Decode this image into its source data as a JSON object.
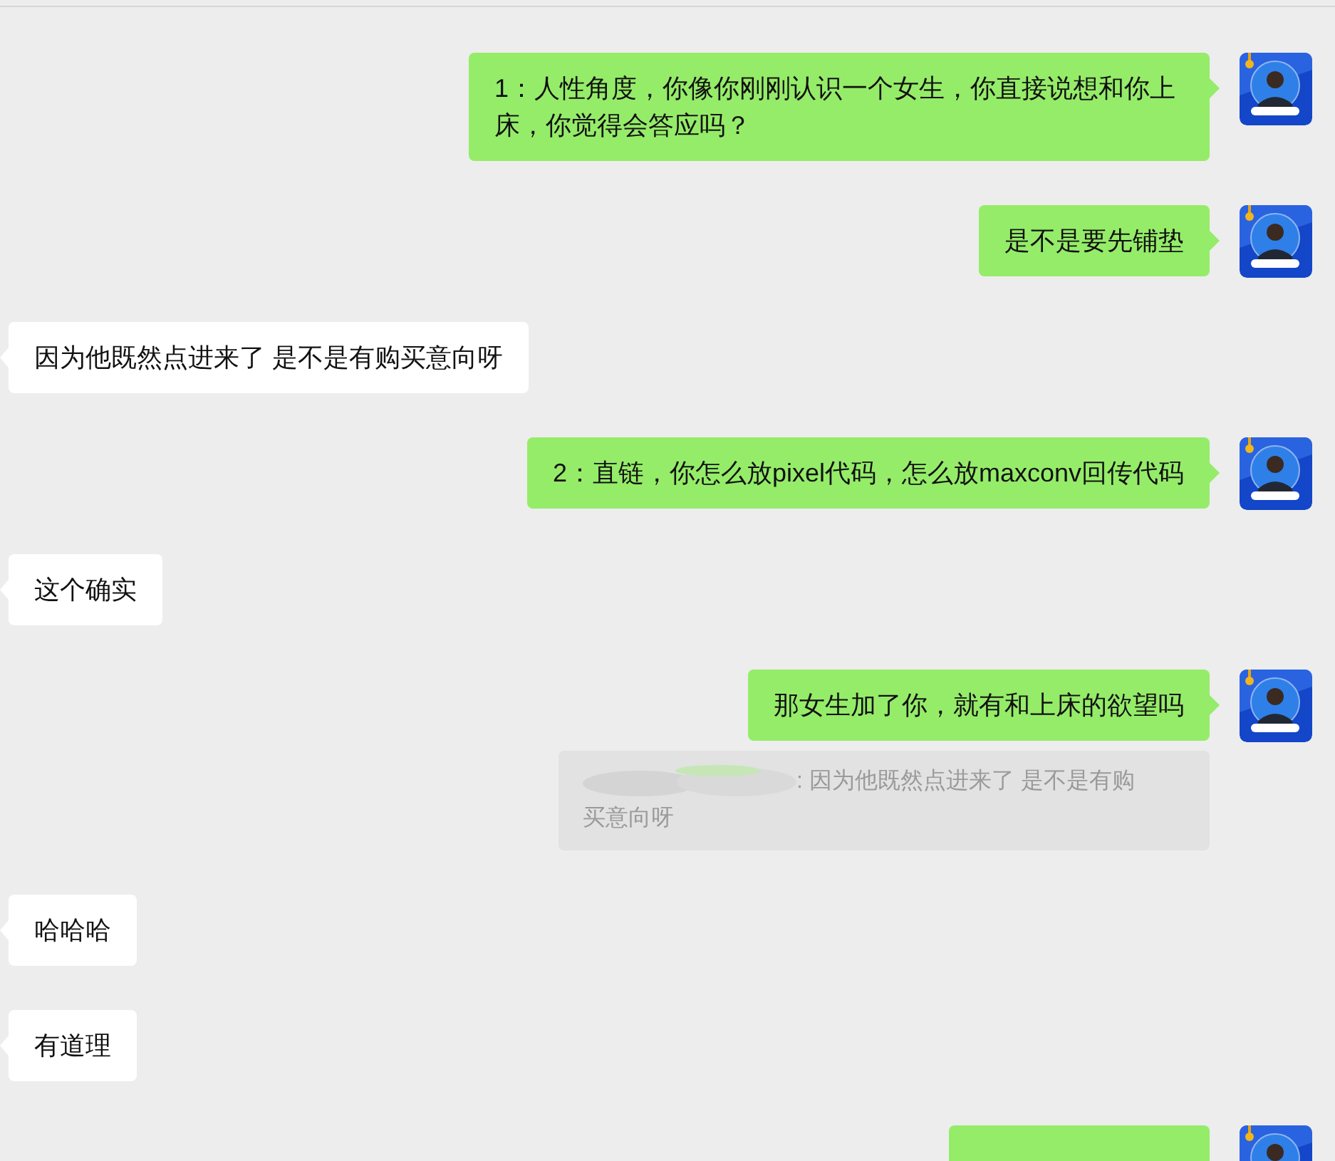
{
  "messages": [
    {
      "kind": "sent",
      "text": "1：人性角度，你像你刚刚认识一个女生，你直接说想和你上床，你觉得会答应吗？"
    },
    {
      "kind": "sent",
      "text": "是不是要先铺垫"
    },
    {
      "kind": "received",
      "text": "因为他既然点进来了 是不是有购买意向呀"
    },
    {
      "kind": "sent",
      "text": "2：直链，你怎么放pixel代码，怎么放maxconv回传代码"
    },
    {
      "kind": "received",
      "text": "这个确实"
    },
    {
      "kind": "sent",
      "text": "那女生加了你，就有和上床的欲望吗",
      "quote": {
        "lines": [
          ": 因为他既然点进来了 是不是有购",
          "买意向呀"
        ]
      }
    },
    {
      "kind": "received",
      "text": "哈哈哈"
    },
    {
      "kind": "received",
      "text": "有道理"
    },
    {
      "kind": "sent_cut_off"
    }
  ]
}
